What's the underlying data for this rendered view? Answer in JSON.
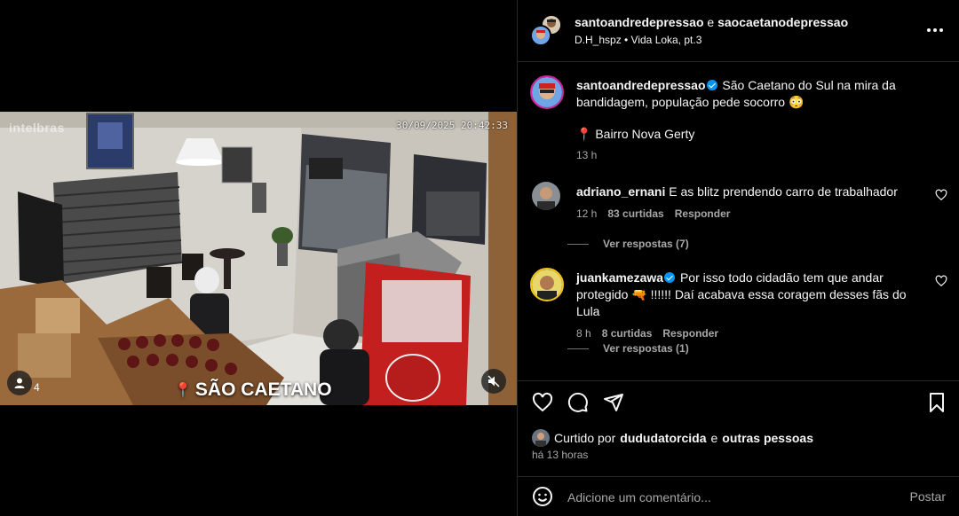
{
  "video": {
    "camera_brand": "intelbras",
    "timestamp": "30/09/2025 20:42:33",
    "caption": "SÃO CAETANO",
    "tag_count": "4",
    "tag_icon": "user-icon",
    "mute_icon": "muted-speaker-icon"
  },
  "header": {
    "user1": "santoandredepressao",
    "and": "e",
    "user2": "saocaetanodepressao",
    "audio": "D.H_hspz • Vida Loka, pt.3"
  },
  "post": {
    "username": "santoandredepressao",
    "verified": true,
    "caption": "São Caetano do Sul na mira da bandidagem, população pede socorro 😳",
    "location": "📍 Bairro Nova Gerty",
    "time": "13 h"
  },
  "comments": [
    {
      "username": "adriano_ernani",
      "verified": false,
      "text": "E as blitz prendendo carro de trabalhador",
      "time": "12 h",
      "likes": "83 curtidas",
      "reply_label": "Responder",
      "replies": "Ver respostas (7)"
    },
    {
      "username": "juankamezawa",
      "verified": true,
      "text": "Por isso todo cidadão tem que andar protegido 🔫 !!!!!! Daí acabava essa coragem desses fãs do Lula",
      "time": "8 h",
      "likes": "8 curtidas",
      "reply_label": "Responder",
      "replies": "Ver respostas (1)"
    }
  ],
  "likes": {
    "prefix": "Curtido por",
    "user": "dududatorcida",
    "and": "e",
    "others": "outras pessoas",
    "time_ago": "há 13 horas"
  },
  "add_comment": {
    "placeholder": "Adicione um comentário...",
    "post_label": "Postar"
  },
  "colors": {
    "background": "#000000",
    "text": "#f5f5f5",
    "secondary_text": "#a8a8a8",
    "verified": "#0095f6",
    "divider": "#262626"
  }
}
